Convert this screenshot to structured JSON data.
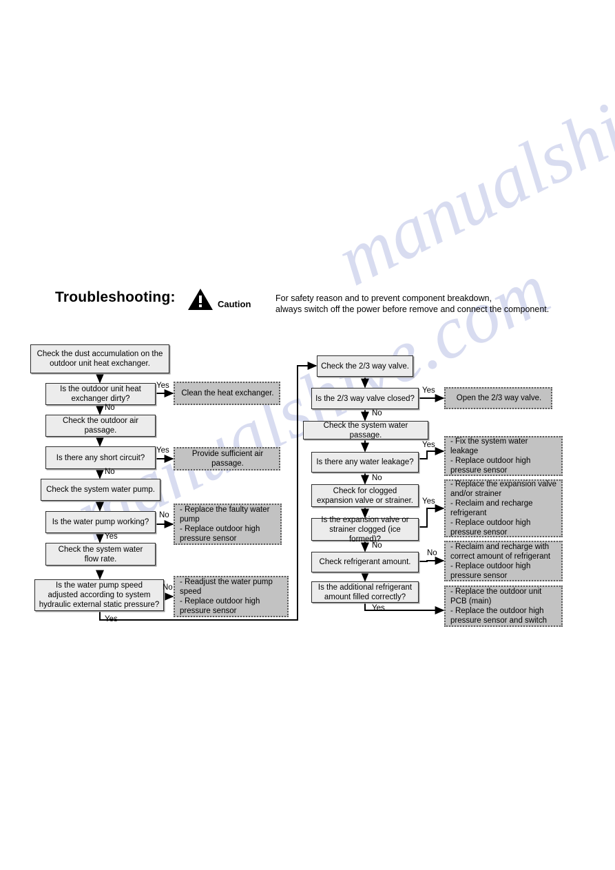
{
  "header": {
    "title": "Troubleshooting:",
    "caution_label": "Caution",
    "caution_icon": "warning-triangle-icon",
    "caution_text_line1": "For safety reason and to prevent component breakdown,",
    "caution_text_line2": "always switch off the power before remove and connect the component."
  },
  "watermark": {
    "text_1": "manualshive.com",
    "text_2": "manualshive.com"
  },
  "colors": {
    "process_fill": "#ececec",
    "process_border": "#2a2a2a",
    "action_fill": "#c2c2c2",
    "action_border": "#585858",
    "wire": "#000000",
    "watermark": "#b9c0e4"
  },
  "left_column": {
    "nodes": [
      {
        "id": "l1",
        "type": "process",
        "text": "Check the dust accumulation on the\noutdoor unit heat exchanger."
      },
      {
        "id": "l2",
        "type": "decision",
        "text": "Is the outdoor unit heat\nexchanger dirty?"
      },
      {
        "id": "l3",
        "type": "process",
        "text": "Check the outdoor air\npassage."
      },
      {
        "id": "l4",
        "type": "decision",
        "text": "Is there any short circuit?"
      },
      {
        "id": "l5",
        "type": "process",
        "text": "Check the system water pump."
      },
      {
        "id": "l6",
        "type": "decision",
        "text": "Is the water pump working?"
      },
      {
        "id": "l7",
        "type": "process",
        "text": "Check the system water\nflow rate."
      },
      {
        "id": "l8",
        "type": "decision",
        "text": "Is the water pump speed\nadjusted according to system\nhydraulic external static pressure?"
      }
    ],
    "actions": [
      {
        "id": "la1",
        "text": "Clean the heat exchanger."
      },
      {
        "id": "la2",
        "text": "Provide sufficient air\npassage."
      },
      {
        "id": "la3",
        "text": "- Replace the faulty water\npump\n- Replace outdoor high\npressure sensor"
      },
      {
        "id": "la4",
        "text": "- Readjust the water pump\nspeed\n- Replace outdoor high\npressure sensor"
      }
    ],
    "edge_labels": [
      {
        "id": "l2-yes",
        "text": "Yes"
      },
      {
        "id": "l2-no",
        "text": "No"
      },
      {
        "id": "l4-yes",
        "text": "Yes"
      },
      {
        "id": "l4-no",
        "text": "No"
      },
      {
        "id": "l6-no",
        "text": "No"
      },
      {
        "id": "l6-yes",
        "text": "Yes"
      },
      {
        "id": "l8-no",
        "text": "No"
      },
      {
        "id": "l8-yes",
        "text": "Yes"
      }
    ]
  },
  "right_column": {
    "nodes": [
      {
        "id": "r1",
        "type": "process",
        "text": "Check the 2/3 way valve."
      },
      {
        "id": "r2",
        "type": "decision",
        "text": "Is the 2/3 way valve closed?"
      },
      {
        "id": "r3",
        "type": "process",
        "text": "Check the system water passage."
      },
      {
        "id": "r4",
        "type": "decision",
        "text": "Is there any water leakage?"
      },
      {
        "id": "r5",
        "type": "process",
        "text": "Check for clogged\nexpansion valve or strainer."
      },
      {
        "id": "r6",
        "type": "decision",
        "text": "Is the expansion valve or\nstrainer clogged (ice formed)?"
      },
      {
        "id": "r7",
        "type": "process",
        "text": "Check refrigerant amount."
      },
      {
        "id": "r8",
        "type": "decision",
        "text": "Is the additional refrigerant\namount filled correctly?"
      }
    ],
    "actions": [
      {
        "id": "ra1",
        "text": "Open the 2/3 way valve."
      },
      {
        "id": "ra2",
        "text": "- Fix the system water\nleakage\n- Replace outdoor high\npressure sensor"
      },
      {
        "id": "ra3",
        "text": "- Replace the expansion valve\nand/or strainer\n- Reclaim and recharge\nrefrigerant\n- Replace outdoor high\npressure sensor"
      },
      {
        "id": "ra4",
        "text": "- Reclaim and recharge with\ncorrect amount of refrigerant\n- Replace outdoor high\npressure sensor"
      },
      {
        "id": "ra5",
        "text": "- Replace the outdoor unit\nPCB (main)\n- Replace the outdoor high\npressure sensor and switch"
      }
    ],
    "edge_labels": [
      {
        "id": "r2-yes",
        "text": "Yes"
      },
      {
        "id": "r2-no",
        "text": "No"
      },
      {
        "id": "r4-yes",
        "text": "Yes"
      },
      {
        "id": "r4-no",
        "text": "No"
      },
      {
        "id": "r6-yes",
        "text": "Yes"
      },
      {
        "id": "r6-no",
        "text": "No"
      },
      {
        "id": "r8-no",
        "text": "No"
      },
      {
        "id": "r8-yes",
        "text": "Yes"
      }
    ]
  }
}
